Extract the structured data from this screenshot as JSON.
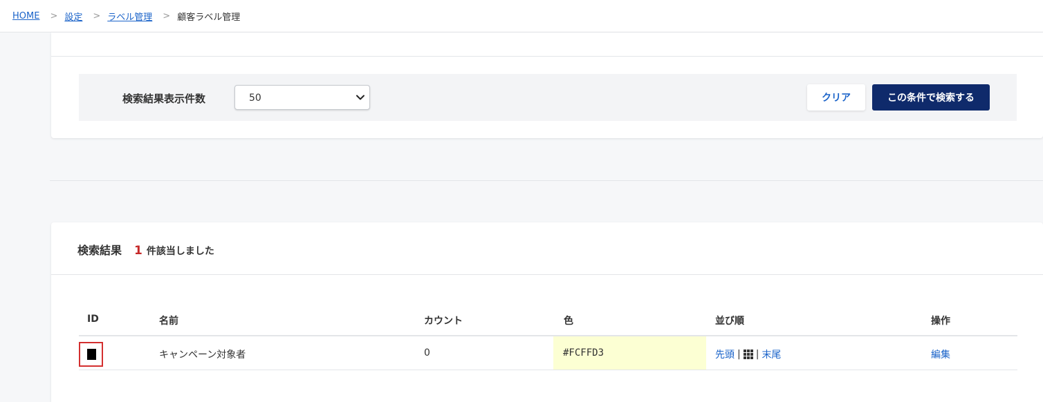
{
  "breadcrumb": [
    {
      "label": "HOME",
      "link": true
    },
    {
      "label": "設定",
      "link": true
    },
    {
      "label": "ラベル管理",
      "link": true
    },
    {
      "label": "顧客ラベル管理",
      "link": false
    }
  ],
  "breadcrumb_separator": ">",
  "filter": {
    "label": "検索結果表示件数",
    "per_page_value": "50",
    "clear_button": "クリア",
    "search_button": "この条件で検索する"
  },
  "results": {
    "title": "検索結果",
    "count": "1",
    "suffix": "件該当しました",
    "columns": {
      "id": "ID",
      "name": "名前",
      "count": "カウント",
      "color": "色",
      "order": "並び順",
      "actions": "操作"
    },
    "rows": [
      {
        "name": "キャンペーン対象者",
        "count": "0",
        "color": "#FCFFD3",
        "order_first": "先頭",
        "order_last": "末尾",
        "edit": "編集"
      }
    ]
  },
  "colors": {
    "link": "#1a63c9",
    "primary_button": "#0f2a6b",
    "count_highlight": "#c62828",
    "row_color_swatch": "#FCFFD3"
  }
}
